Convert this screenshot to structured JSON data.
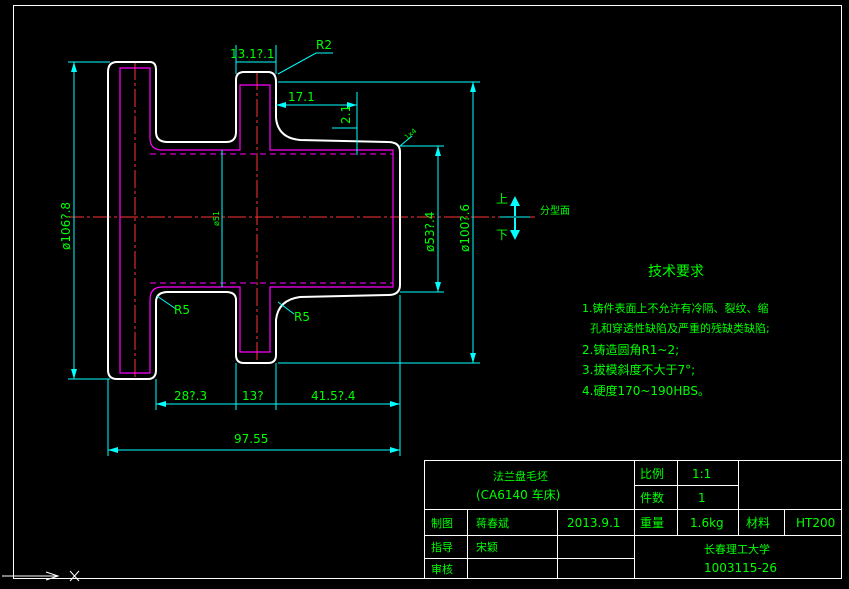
{
  "colors": {
    "background": "#000000",
    "border": "#ffffff",
    "part_outline": "#ffffff",
    "hidden_line": "#ff00ff",
    "center_line": "#ff3333",
    "dimension": "#00ffff",
    "text": "#00ff00",
    "arrow": "#00ffff"
  },
  "dimensions": {
    "top_width": "13.1?.1",
    "radius_top": "R2",
    "flange_step": "17.1",
    "vertical_small": "2.1",
    "radius_left": "R5",
    "radius_right": "R5",
    "dia_left": "ø106?.8",
    "dia_inner": "ø51",
    "dia_mid": "ø53?.4",
    "dia_right": "ø100?.6",
    "len_a": "28?.3",
    "len_b": "13?",
    "len_c": "41.5?.4",
    "len_total": "97.55",
    "angle_mark": "1x4"
  },
  "parting": {
    "upper": "上",
    "lower": "下",
    "label": "分型面"
  },
  "notes": {
    "title": "技术要求",
    "lines": [
      "1.铸件表面上不允许有冷隔、裂纹、缩",
      "孔和穿透性缺陷及严重的残缺类缺陷;",
      "2.铸造圆角R1~2;",
      "3.拔模斜度不大于7°;",
      "4.硬度170~190HBS。"
    ]
  },
  "title_block": {
    "part_name": "法兰盘毛坯",
    "part_model": "(CA6140 车床)",
    "scale_label": "比例",
    "scale_value": "1:1",
    "qty_label": "件数",
    "qty_value": "1",
    "drawn_label": "制图",
    "drawn_name": "蒋春斌",
    "drawn_date": "2013.9.1",
    "weight_label": "重量",
    "weight_value": "1.6kg",
    "material_label": "材料",
    "material_value": "HT200",
    "guide_label": "指导",
    "guide_name": "宋颖",
    "check_label": "审核",
    "school": "长春理工大学",
    "student_id": "1003115-26"
  }
}
